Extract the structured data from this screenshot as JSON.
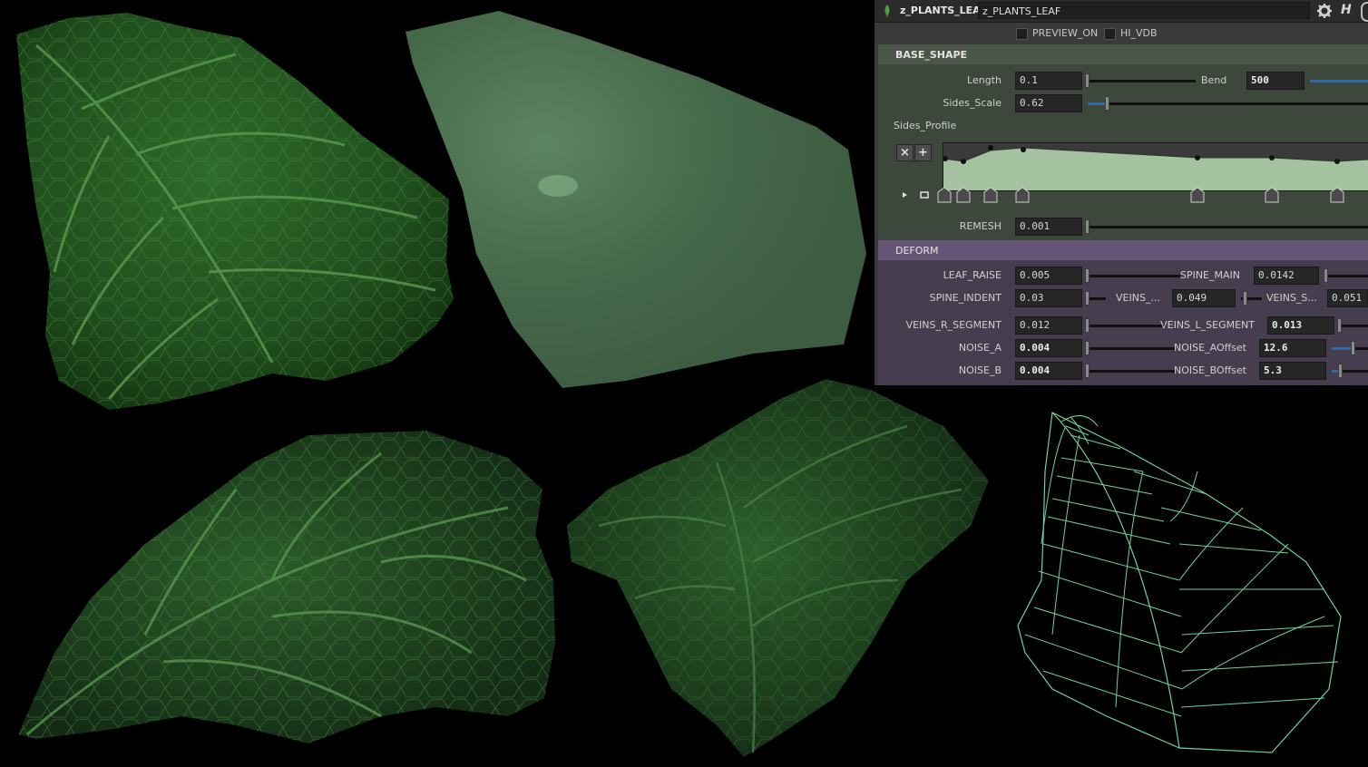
{
  "node": {
    "type": "z_PLANTS_LEAF",
    "name": "z_PLANTS_LEAF"
  },
  "toggles": [
    {
      "label": "PREVIEW_ON",
      "checked": false
    },
    {
      "label": "HI_VDB",
      "checked": false
    }
  ],
  "base_shape": {
    "title": "BASE_SHAPE",
    "length": {
      "label": "Length",
      "value": "0.1"
    },
    "bend": {
      "label": "Bend",
      "value": "500"
    },
    "sides_scale": {
      "label": "Sides_Scale",
      "value": "0.62"
    },
    "sides_profile": {
      "label": "Sides_Profile",
      "remove_label": "×",
      "add_label": "+"
    },
    "remesh": {
      "label": "REMESH",
      "value": "0.001"
    }
  },
  "deform": {
    "title": "DEFORM",
    "leaf_raise": {
      "label": "LEAF_RAISE",
      "value": "0.005"
    },
    "spine_main": {
      "label": "SPINE_MAIN",
      "value": "0.0142"
    },
    "spine_indent": {
      "label": "SPINE_INDENT",
      "value": "0.03"
    },
    "veins_a": {
      "label": "VEINS_...",
      "value": "0.049"
    },
    "veins_s": {
      "label": "VEINS_S...",
      "value": "0.051"
    },
    "veins_r_segment": {
      "label": "VEINS_R_SEGMENT",
      "value": "0.012"
    },
    "veins_l_segment": {
      "label": "VEINS_L_SEGMENT",
      "value": "0.013"
    },
    "noise_a": {
      "label": "NOISE_A",
      "value": "0.004"
    },
    "noise_aoffset": {
      "label": "NOISE_AOffset",
      "value": "12.6"
    },
    "noise_b": {
      "label": "NOISE_B",
      "value": "0.004"
    },
    "noise_boffset": {
      "label": "NOISE_BOffset",
      "value": "5.3"
    }
  },
  "colors": {
    "leaf_dark": "#1f4a1c",
    "leaf_mid": "#2e6a29",
    "flat_mesh": "#45684a",
    "wireframe": "#6fd39a",
    "base_header": "#4a5647",
    "deform_header": "#665476"
  },
  "icons": [
    "leaf-node-icon",
    "gear-icon",
    "help-icon",
    "play-icon",
    "fit-icon"
  ]
}
